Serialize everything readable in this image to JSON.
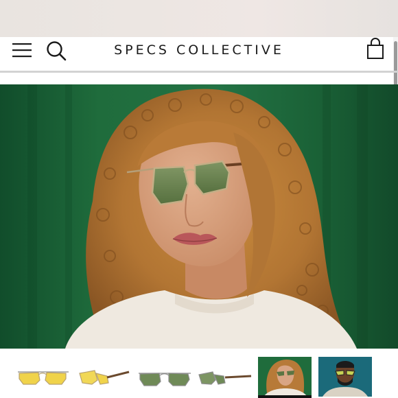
{
  "header": {
    "brand": "SPECS COLLECTIVE",
    "icons": [
      "menu-icon",
      "search-icon",
      "shopping-bag-icon"
    ]
  },
  "hero": {
    "subject": "model wearing sunglasses",
    "background_color": "#1e6b3b"
  },
  "thumbnails": [
    {
      "name": "thumb-yellow-front"
    },
    {
      "name": "thumb-yellow-side"
    },
    {
      "name": "thumb-green-front"
    },
    {
      "name": "thumb-green-side"
    },
    {
      "name": "thumb-model-woman",
      "selected": true
    },
    {
      "name": "thumb-model-man"
    }
  ],
  "colors": {
    "accent": "#111111",
    "divider": "#d3d3d3",
    "lens_yellow": "#f0d34a",
    "lens_green": "#6f8a57"
  }
}
